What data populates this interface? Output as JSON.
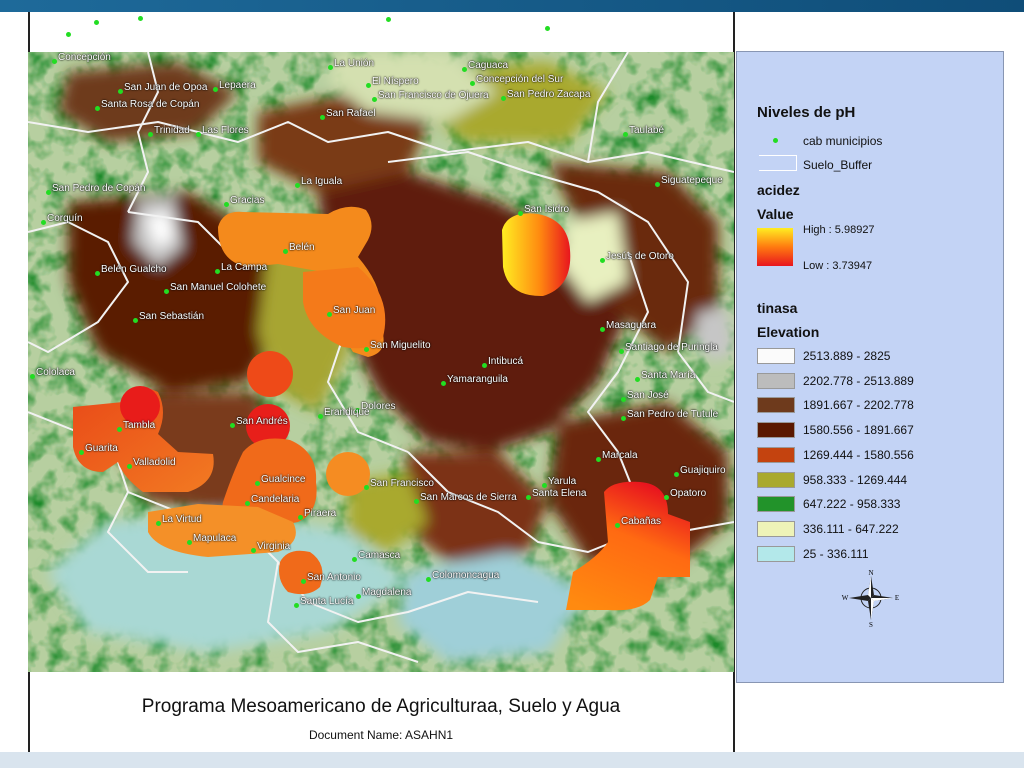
{
  "title": "Programa Mesoamericano de Agriculturaa, Suelo y Agua",
  "document_label": "Document Name: ASAHN1",
  "legend": {
    "heading": "Niveles de pH",
    "layers": [
      {
        "label": "cab municipios",
        "icon": "green-dot"
      },
      {
        "label": "Suelo_Buffer",
        "icon": "white-outline-polygon"
      }
    ],
    "acidez": {
      "heading": "acidez",
      "value_heading": "Value",
      "high_label": "High : 5.98927",
      "low_label": "Low : 3.73947",
      "colors": [
        "#ffee22",
        "#ff7a10",
        "#e8151e"
      ]
    },
    "tinasa": {
      "heading": "tinasa",
      "elevation_heading": "Elevation",
      "classes": [
        {
          "label": "2513.889 - 2825",
          "color": "#fbfbfb"
        },
        {
          "label": "2202.778 - 2513.889",
          "color": "#bcbcbc"
        },
        {
          "label": "1891.667 - 2202.778",
          "color": "#6e3a1c"
        },
        {
          "label": "1580.556 - 1891.667",
          "color": "#5a1800"
        },
        {
          "label": "1269.444 - 1580.556",
          "color": "#c4430f"
        },
        {
          "label": "958.333 - 1269.444",
          "color": "#a9a92e"
        },
        {
          "label": "647.222 - 958.333",
          "color": "#22932a"
        },
        {
          "label": "336.111 - 647.222",
          "color": "#eef3b8"
        },
        {
          "label": "25 - 336.111",
          "color": "#b3e8ea"
        }
      ]
    },
    "north_arrow": {
      "n": "N",
      "s": "S",
      "e": "E",
      "w": "W"
    }
  },
  "towns": [
    {
      "name": "Concepción"
    },
    {
      "name": "La Unión"
    },
    {
      "name": "Caguaca"
    },
    {
      "name": "El Níspero"
    },
    {
      "name": "Concepción del Sur"
    },
    {
      "name": "San Juan de Opoa"
    },
    {
      "name": "Lepaera"
    },
    {
      "name": "San Francisco de Ojuera"
    },
    {
      "name": "San Pedro Zacapa"
    },
    {
      "name": "Santa Rosa de Copán"
    },
    {
      "name": "San Rafael"
    },
    {
      "name": "Trinidad"
    },
    {
      "name": "Las Flores"
    },
    {
      "name": "Taulabé"
    },
    {
      "name": "San Pedro de Copán"
    },
    {
      "name": "Gracias"
    },
    {
      "name": "La Iguala"
    },
    {
      "name": "Siguatepeque"
    },
    {
      "name": "Corquín"
    },
    {
      "name": "San Isidro"
    },
    {
      "name": "Belén"
    },
    {
      "name": "Belén Gualcho"
    },
    {
      "name": "La Campa"
    },
    {
      "name": "Jesús de Otoro"
    },
    {
      "name": "San Manuel Colohete"
    },
    {
      "name": "San Juan"
    },
    {
      "name": "San Sebastián"
    },
    {
      "name": "Masaguara"
    },
    {
      "name": "San Miguelito"
    },
    {
      "name": "Santiago de Puringla"
    },
    {
      "name": "Intibucá"
    },
    {
      "name": "Cololaca"
    },
    {
      "name": "Yamaranguila"
    },
    {
      "name": "Santa María"
    },
    {
      "name": "San José"
    },
    {
      "name": "Dolores"
    },
    {
      "name": "San Pedro de Tutule"
    },
    {
      "name": "Erandique"
    },
    {
      "name": "San Andrés"
    },
    {
      "name": "Tambla"
    },
    {
      "name": "Guarita"
    },
    {
      "name": "Marcala"
    },
    {
      "name": "Valladolid"
    },
    {
      "name": "Gualcince"
    },
    {
      "name": "Guajiquiro"
    },
    {
      "name": "San Francisco"
    },
    {
      "name": "Yarula"
    },
    {
      "name": "Santa Elena"
    },
    {
      "name": "Candelaria"
    },
    {
      "name": "San Marcos de Sierra"
    },
    {
      "name": "Opatoro"
    },
    {
      "name": "Piraera"
    },
    {
      "name": "La Virtud"
    },
    {
      "name": "Cabañas"
    },
    {
      "name": "Mapulaca"
    },
    {
      "name": "Virginia"
    },
    {
      "name": "Camasca"
    },
    {
      "name": "Colomoncagua"
    },
    {
      "name": "San Antonio"
    },
    {
      "name": "Magdalena"
    },
    {
      "name": "Santa Lucía"
    }
  ]
}
